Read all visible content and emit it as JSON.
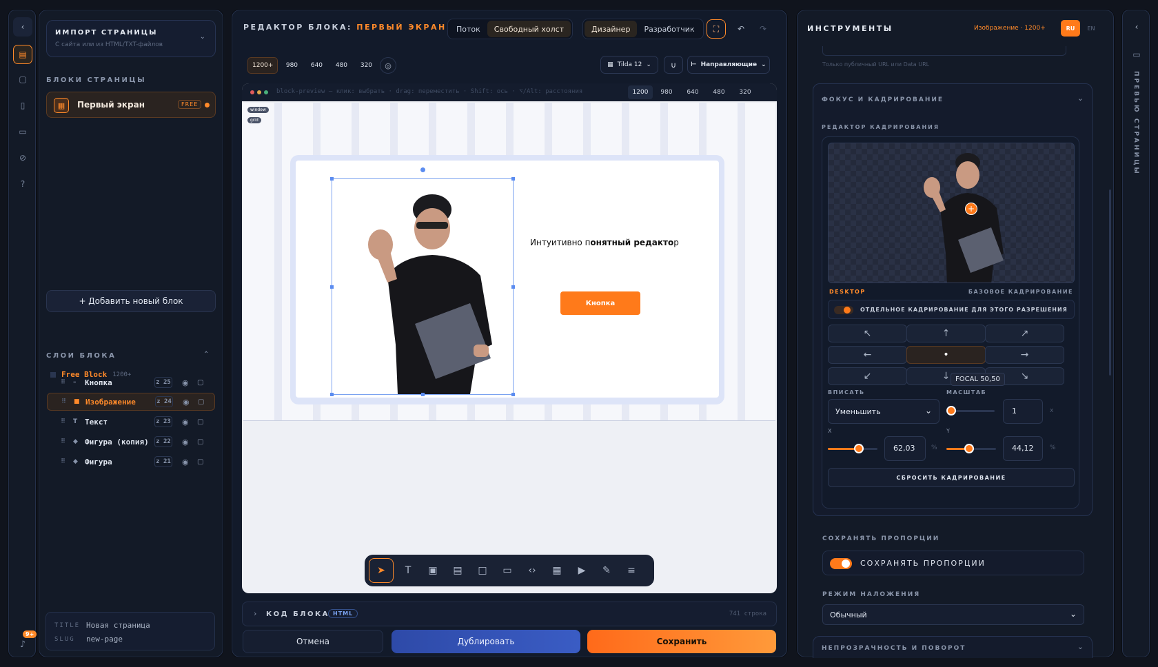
{
  "left_sidebar": {
    "notification_count": "9+"
  },
  "left_panel": {
    "import": {
      "title": "ИМПОРТ СТРАНИЦЫ",
      "subtitle": "С сайта или из HTML/TXT-файлов"
    },
    "blocks_heading": "БЛОКИ СТРАНИЦЫ",
    "block_item": {
      "label": "Первый экран",
      "badge": "FREE"
    },
    "add_block": "+ Добавить новый блок",
    "layers_heading": "СЛОИ БЛОКА",
    "layer_root": {
      "label": "Free Block",
      "meta": "1200+"
    },
    "layers": [
      {
        "icon": "–",
        "label": "Кнопка",
        "z": "z 25"
      },
      {
        "icon": "■",
        "label": "Изображение",
        "z": "z 24"
      },
      {
        "icon": "T",
        "label": "Текст",
        "z": "z 23"
      },
      {
        "icon": "◆",
        "label": "Фигура (копия)",
        "z": "z 22"
      },
      {
        "icon": "◆",
        "label": "Фигура",
        "z": "z 21"
      }
    ],
    "meta": {
      "title_key": "TITLE",
      "title_val": "Новая страница",
      "slug_key": "SLUG",
      "slug_val": "new-page"
    }
  },
  "editor": {
    "title_prefix": "РЕДАКТОР БЛОКА:",
    "title_name": "ПЕРВЫЙ ЭКРАН",
    "mode_tabs": [
      "Поток",
      "Свободный холст"
    ],
    "role_tabs": [
      "Дизайнер",
      "Разработчик"
    ],
    "breakpoints": [
      "1200+",
      "980",
      "640",
      "480",
      "320"
    ],
    "grid_select": "Tilda 12",
    "guides_select": "Направляющие",
    "preview_info": "block-preview — клик: выбрать · drag: переместить · Shift: ось · ⌥/Alt: расстояния",
    "preview_widths": [
      "1200",
      "980",
      "640",
      "480",
      "320"
    ],
    "tags": [
      "window",
      "grid"
    ],
    "canvas": {
      "headline_a": "Интуитивно п",
      "headline_b": "онятный редакто",
      "headline_c": "р",
      "button": "Кнопка"
    },
    "code": {
      "label": "КОД БЛОКА",
      "badge": "HTML",
      "lines": "741 строка"
    },
    "actions": {
      "cancel": "Отмена",
      "duplicate": "Дублировать",
      "save": "Сохранить"
    }
  },
  "tools_panel": {
    "title": "ИНСТРУМЕНТЫ",
    "context": "Изображение · 1200+",
    "lang": [
      "RU",
      "EN"
    ],
    "url_hint": "Только публичный URL или Data URL",
    "focus_section": "ФОКУС И КАДРИРОВАНИЕ",
    "crop_editor": "РЕДАКТОР КАДРИРОВАНИЯ",
    "desktop": "DESKTOP",
    "base_crop": "БАЗОВОЕ КАДРИРОВАНИЕ",
    "separate_crop": "ОТДЕЛЬНОЕ КАДРИРОВАНИЕ ДЛЯ ЭТОГО РАЗРЕШЕНИЯ",
    "arrows": [
      "↖",
      "↑",
      "↗",
      "←",
      "•",
      "→",
      "↙",
      "↓",
      "↘"
    ],
    "focal": "FOCAL 50,50",
    "fit_label": "ВПИСАТЬ",
    "fit_value": "Уменьшить",
    "scale_label": "МАСШТАБ",
    "scale_value": "1",
    "scale_unit": "x",
    "x_label": "X",
    "x_value": "62,03",
    "x_unit": "%",
    "y_label": "Y",
    "y_value": "44,12",
    "y_unit": "%",
    "reset": "СБРОСИТЬ КАДРИРОВАНИЕ",
    "ratio_heading": "СОХРАНЯТЬ ПРОПОРЦИИ",
    "ratio_toggle": "СОХРАНЯТЬ ПРОПОРЦИИ",
    "blend_heading": "РЕЖИМ НАЛОЖЕНИЯ",
    "blend_value": "Обычный",
    "opacity_section": "НЕПРОЗРАЧНОСТЬ И ПОВОРОТ"
  },
  "right_rail": {
    "label": "ПРЕВЬЮ СТРАНИЦЫ"
  },
  "colors": {
    "accent": "#ff8a2a",
    "primary": "#3553b8",
    "bg": "#10141d"
  }
}
